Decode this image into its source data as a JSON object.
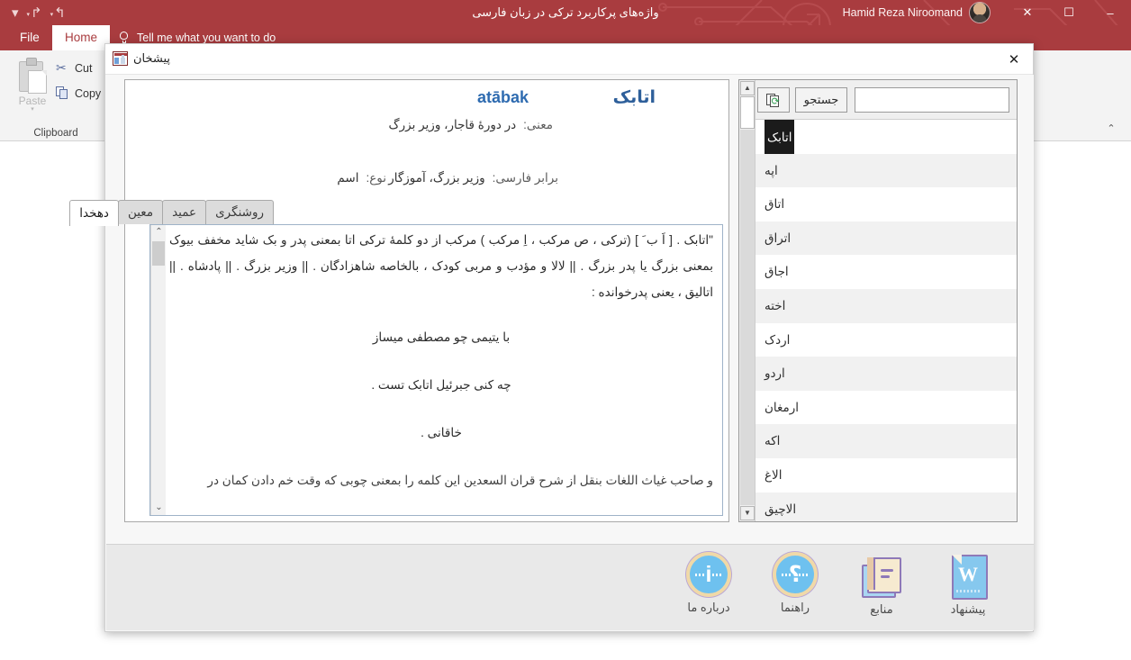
{
  "window": {
    "title": "واژه‌های پرکاربرد ترکی در زبان فارسی",
    "account_name": "Hamid Reza Niroomand",
    "minimize": "–",
    "maximize": "☐",
    "close": "✕",
    "quick_access": {
      "undo": "↰",
      "redo": "↱",
      "customize": "▾"
    }
  },
  "ribbon": {
    "tabs": [
      {
        "label": "File"
      },
      {
        "label": "Home"
      }
    ],
    "tell_me": "Tell me what you want to do",
    "clipboard": {
      "group_label": "Clipboard",
      "paste_label": "Paste",
      "paste_arrow": "▾",
      "cut_label": "Cut",
      "copy_label": "Copy",
      "scissors_glyph": "✂"
    },
    "collapse_glyph": "⌃"
  },
  "dialog": {
    "title": "پیشخان",
    "close_label": "✕",
    "entry": {
      "headword_fa": "اتابک",
      "headword_translit": "atābak",
      "meaning_label": "معنی:",
      "meaning_value": "در دورهٔ قاجار، وزیر بزرگ",
      "persian_equiv_label": "برابر فارسی:",
      "persian_equiv_value": "وزیر بزرگ، آموزگار",
      "type_label": "نوع:",
      "type_value": "اسم"
    },
    "tabs": [
      {
        "label": "روشنگری",
        "active": false
      },
      {
        "label": "عمید",
        "active": false
      },
      {
        "label": "معین",
        "active": false
      },
      {
        "label": "دهخدا",
        "active": true
      }
    ],
    "article": {
      "paragraphs": [
        "\"اتابک . [ اَ ب َ ] (ترکی ، ص مرکب ، اِ مرکب ) مرکب از دو کلمهٔ ترکی اتا بمعنی پدر و بک شاید مخفف بیوک بمعنی بزرگ یا پدر بزرگ . || لالا و مؤدب و مربی کودک ، بالخاصه شاهزادگان . || وزیر بزرگ . || پادشاه . || اتالیق ، یعنی پدرخوانده :",
        "با یتیمی چو مصطفی میساز",
        "چه کنی جبرئیل اتابک تست .",
        "خاقانی .",
        "و صاحب غیاث اللغات بنقل از شرح قران السعدین این کلمه را بمعنی چوبی که وقت خم دادن کمان در"
      ]
    },
    "search": {
      "value": "",
      "placeholder": "",
      "button_label": "جستجو",
      "refresh_icon": "refresh-pages-icon"
    },
    "word_list": [
      {
        "word": "اتابک",
        "selected": true
      },
      {
        "word": "اپه",
        "selected": false
      },
      {
        "word": "اتاق",
        "selected": false
      },
      {
        "word": "اتراق",
        "selected": false
      },
      {
        "word": "اجاق",
        "selected": false
      },
      {
        "word": "اخته",
        "selected": false
      },
      {
        "word": "اردک",
        "selected": false
      },
      {
        "word": "اردو",
        "selected": false
      },
      {
        "word": "ارمغان",
        "selected": false
      },
      {
        "word": "اکه",
        "selected": false
      },
      {
        "word": "الاغ",
        "selected": false
      },
      {
        "word": "الاچیق",
        "selected": false
      }
    ],
    "scrollbar": {
      "up_glyph": "▲",
      "down_glyph": "▼"
    },
    "article_scrollbar": {
      "up_glyph": "⌃",
      "down_glyph": "⌄"
    },
    "footer_buttons": [
      {
        "label": "پیشنهاد",
        "icon": "word-document-icon"
      },
      {
        "label": "منابع",
        "icon": "books-icon"
      },
      {
        "label": "راهنما",
        "icon": "question-circle-icon"
      },
      {
        "label": "درباره ما",
        "icon": "info-circle-icon"
      }
    ],
    "footer_glyphs": {
      "info": "i",
      "question": "؟"
    }
  },
  "colors": {
    "accent": "#a93c3f",
    "headword": "#2e5f9a",
    "selection": "#1b1b1b"
  }
}
